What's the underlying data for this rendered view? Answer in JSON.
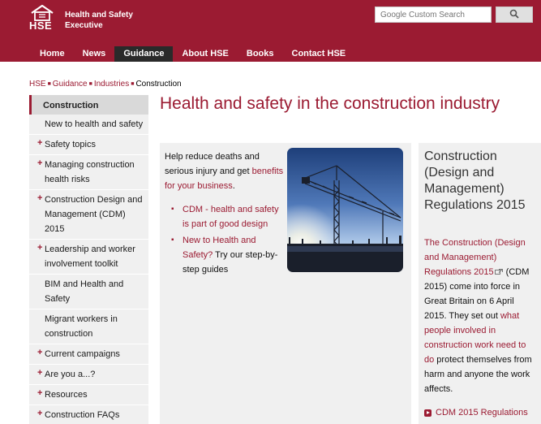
{
  "header": {
    "logo_text": "HSE",
    "org_name": "Health and Safety Executive",
    "search": {
      "placeholder": "Custom Search",
      "brand": "Google"
    },
    "search_button_icon": "magnifier-icon"
  },
  "nav": {
    "items": [
      {
        "label": "Home"
      },
      {
        "label": "News"
      },
      {
        "label": "Guidance",
        "active": true
      },
      {
        "label": "About HSE"
      },
      {
        "label": "Books"
      },
      {
        "label": "Contact HSE"
      }
    ]
  },
  "breadcrumb": {
    "items": [
      "HSE",
      "Guidance",
      "Industries"
    ],
    "current": "Construction"
  },
  "sidebar": {
    "title": "Construction",
    "items": [
      {
        "label": "New to health and safety",
        "expandable": false
      },
      {
        "label": "Safety topics",
        "expandable": true
      },
      {
        "label": "Managing construction health risks",
        "expandable": true
      },
      {
        "label": "Construction Design and Management (CDM) 2015",
        "expandable": true
      },
      {
        "label": "Leadership and worker involvement toolkit",
        "expandable": true
      },
      {
        "label": "BIM and Health and Safety",
        "expandable": false
      },
      {
        "label": "Migrant workers in construction",
        "expandable": false
      },
      {
        "label": "Current campaigns",
        "expandable": true
      },
      {
        "label": "Are you a...?",
        "expandable": true
      },
      {
        "label": "Resources",
        "expandable": true
      },
      {
        "label": "Construction FAQs",
        "expandable": true
      }
    ]
  },
  "main": {
    "title": "Health and safety in the construction industry",
    "intro_text": "Help reduce deaths and serious injury and get",
    "intro_link": "benefits for your business",
    "intro_end": ".",
    "bullets": [
      {
        "link": "CDM - health and safety is part of good design",
        "text": ""
      },
      {
        "link": "New to Health and Safety?",
        "text": " Try our step-by-step guides"
      }
    ],
    "photo_alt": "Construction crane silhouette"
  },
  "right_panel": {
    "title": "Construction (Design and Management) Regulations 2015",
    "link1": "The Construction (Design and Management) Regulations 2015",
    "text1": " (CDM 2015) come into force in Great Britain on 6 April 2015. They set out ",
    "link2": "what people involved in construction work need to do",
    "text2": " protect themselves from harm and anyone the work affects.",
    "bottom_link": "CDM 2015 Regulations"
  },
  "colors": {
    "brand": "#9b1b32",
    "nav_active": "#2a2a2a",
    "panel_bg": "#f0f0f0"
  }
}
